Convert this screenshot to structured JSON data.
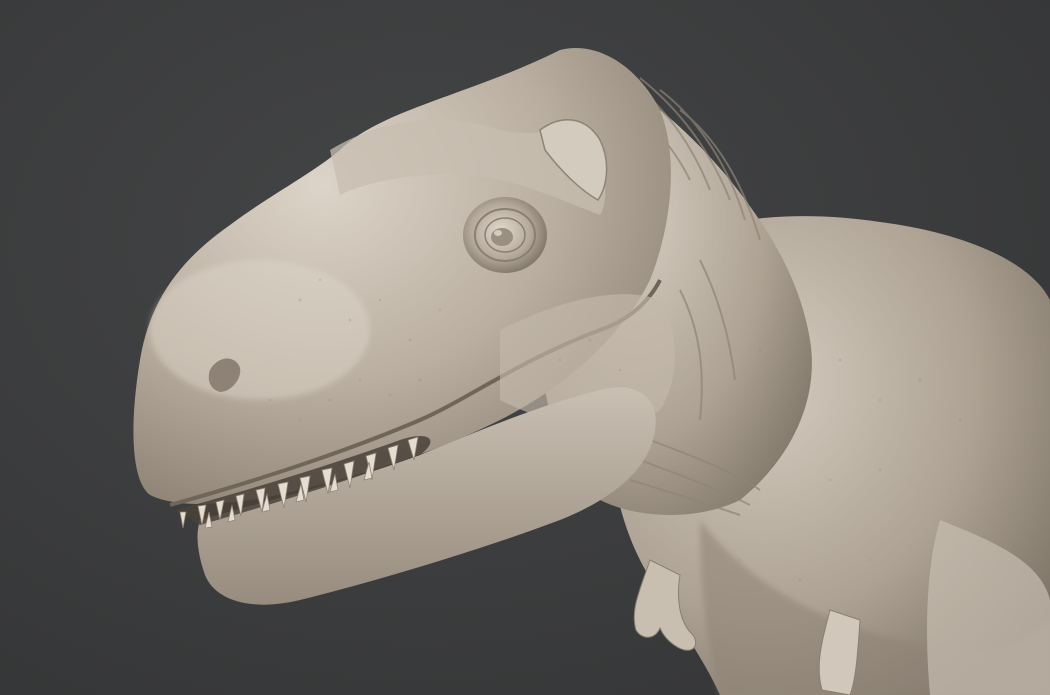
{
  "scene": {
    "subject": "sculpt-trex-head",
    "colors": {
      "background": "#3b3c3d",
      "skin_light": "#d8cfc4",
      "skin_mid": "#b5aa9c",
      "skin_dark": "#7d7366",
      "mouth_shadow": "#4a423a",
      "teeth": "#e6ddd0"
    }
  }
}
